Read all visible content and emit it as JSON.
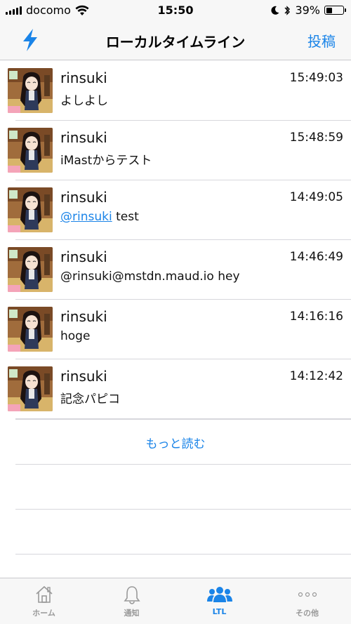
{
  "status_bar": {
    "carrier": "docomo",
    "time": "15:50",
    "battery": "39%",
    "battery_level": 0.39
  },
  "nav": {
    "title": "ローカルタイムライン",
    "left_icon": "lightning-icon",
    "right_label": "投稿"
  },
  "posts": [
    {
      "name": "rinsuki",
      "time": "15:49:03",
      "text": "よしよし"
    },
    {
      "name": "rinsuki",
      "time": "15:48:59",
      "text": "iMastからテスト"
    },
    {
      "name": "rinsuki",
      "time": "14:49:05",
      "mention": "@rinsuki",
      "text": " test"
    },
    {
      "name": "rinsuki",
      "time": "14:46:49",
      "text": "@rinsuki@mstdn.maud.io hey"
    },
    {
      "name": "rinsuki",
      "time": "14:16:16",
      "text": "hoge"
    },
    {
      "name": "rinsuki",
      "time": "14:12:42",
      "text": "記念パピコ"
    }
  ],
  "load_more": "もっと読む",
  "tabs": [
    {
      "label": "ホーム",
      "icon": "home-icon",
      "active": false
    },
    {
      "label": "通知",
      "icon": "bell-icon",
      "active": false
    },
    {
      "label": "LTL",
      "icon": "people-icon",
      "active": true
    },
    {
      "label": "その他",
      "icon": "more-icon",
      "active": false
    }
  ],
  "colors": {
    "accent": "#1a84e8",
    "inactive": "#999999",
    "bar_background": "#f7f7f7"
  }
}
